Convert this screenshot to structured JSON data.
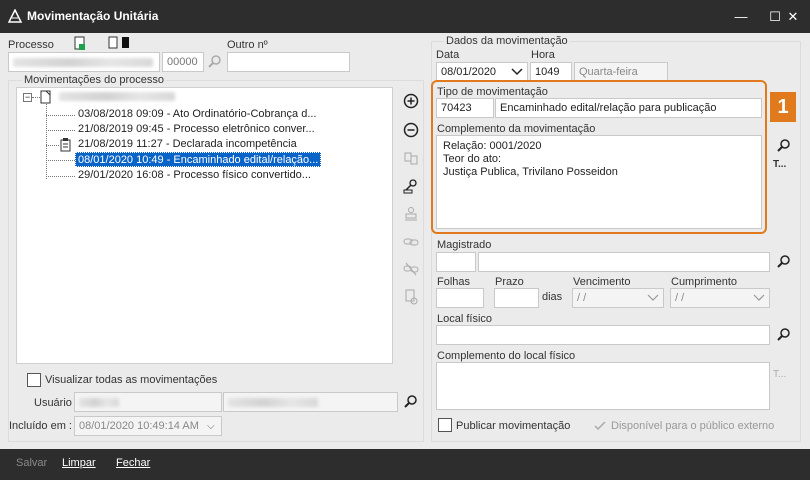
{
  "window": {
    "title": "Movimentação Unitária",
    "minimize": "—",
    "maximize": "☐",
    "close": "✕"
  },
  "processo": {
    "label": "Processo",
    "sequence": "00000",
    "outro_label": "Outro nº",
    "outro_value": ""
  },
  "tree": {
    "label": "Movimentações do processo",
    "items": [
      {
        "text": "03/08/2018 09:09 - Ato Ordinatório-Cobrança d...",
        "selected": false
      },
      {
        "text": "21/08/2019 09:45 - Processo eletrônico conver...",
        "selected": false
      },
      {
        "text": "21/08/2019 11:27 - Declarada incompetência",
        "selected": false
      },
      {
        "text": "08/01/2020 10:49 - Encaminhado edital/relação...",
        "selected": true
      },
      {
        "text": "29/01/2020 16:08 - Processo físico convertido...",
        "selected": false
      }
    ]
  },
  "visualizar_label": "Visualizar todas as movimentações",
  "usuario_label": "Usuário",
  "incluido": {
    "label": "Incluído em :",
    "value": "08/01/2020 10:49:14 AM"
  },
  "dados": {
    "group_label": "Dados da movimentação",
    "data_label": "Data",
    "data_value": "08/01/2020",
    "hora_label": "Hora",
    "hora_value": "1049",
    "weekday": "Quarta-feira",
    "tipo_label": "Tipo de movimentação",
    "tipo_code": "70423",
    "tipo_desc": "Encaminhado edital/relação para publicação",
    "complemento_label": "Complemento da movimentação",
    "complemento_text": "Relação: 0001/2020\nTeor do ato:\nJustiça Publica, Trivilano Posseidon",
    "magistrado_label": "Magistrado",
    "folhas_label": "Folhas",
    "prazo_label": "Prazo",
    "dias_label": "dias",
    "vencimento_label": "Vencimento",
    "vencimento_value": "/  /",
    "cumprimento_label": "Cumprimento",
    "cumprimento_value": "/  /",
    "local_label": "Local físico",
    "complemento_local_label": "Complemento do local físico",
    "publicar_label": "Publicar movimentação",
    "disponivel_label": "Disponível para o público externo",
    "t_label": "T..."
  },
  "badge": "1",
  "footer": {
    "salvar": "Salvar",
    "limpar": "Limpar",
    "fechar": "Fechar"
  },
  "colors": {
    "accent": "#e07a1c",
    "selection": "#0a64c8",
    "titlebar": "#2d2d2d"
  }
}
